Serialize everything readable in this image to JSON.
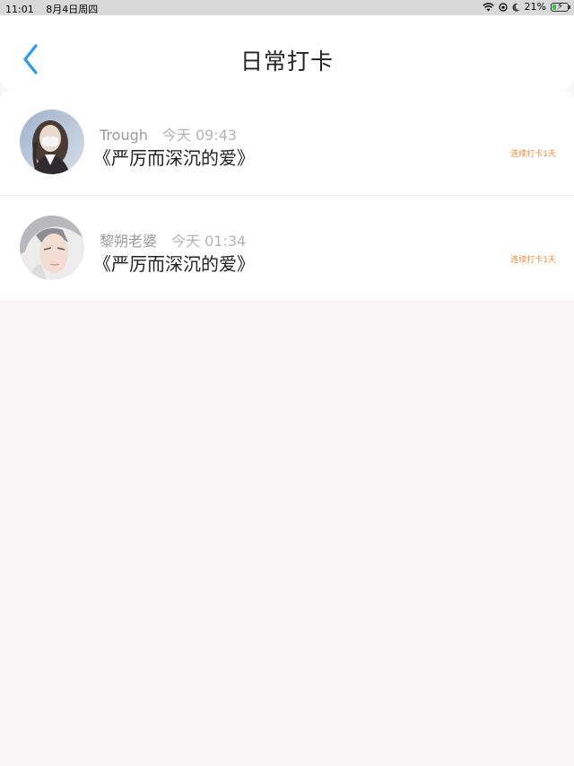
{
  "status_bar": {
    "time": "11:01",
    "date": "8月4日周四",
    "battery": "21%",
    "battery_level": 0.21
  },
  "header": {
    "title": "日常打卡"
  },
  "checkins": [
    {
      "user": "Trough",
      "time": "今天 09:43",
      "book": "《严厉而深沉的爱》",
      "streak": "连续打卡1天"
    },
    {
      "user": "黎朔老婆",
      "time": "今天 01:34",
      "book": "《严厉而深沉的爱》",
      "streak": "连续打卡1天"
    }
  ],
  "colors": {
    "accent": "#2f9be6",
    "streak": "#f08a3a",
    "background": "#f7f5f6"
  }
}
